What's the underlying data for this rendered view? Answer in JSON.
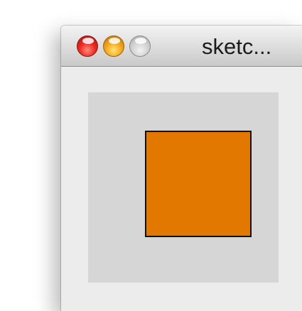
{
  "window": {
    "title": "sketc..."
  },
  "controls": {
    "close": "close-button",
    "minimize": "minimize-button",
    "zoom": "zoom-button"
  },
  "canvas": {
    "background_color": "#d6d6d6",
    "shape": "square",
    "fill_color": "#e37800",
    "stroke_color": "#111111"
  }
}
